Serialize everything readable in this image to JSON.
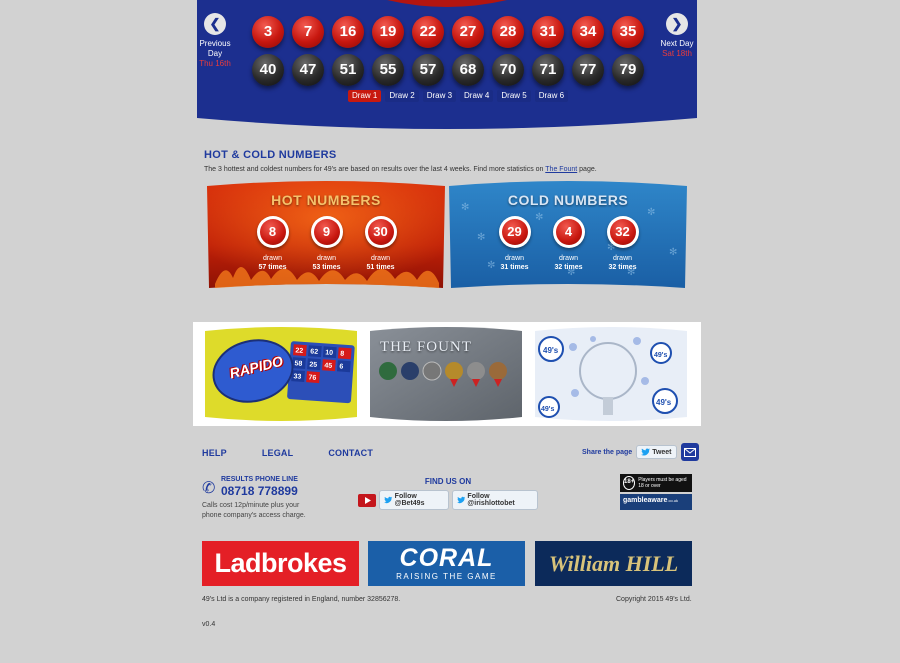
{
  "draw_panel": {
    "prev": {
      "label": "Previous Day",
      "date": "Thu 16th"
    },
    "next": {
      "label": "Next Day",
      "date": "Sat 18th"
    },
    "red_balls": [
      "3",
      "7",
      "16",
      "19",
      "22",
      "27",
      "28",
      "31",
      "34",
      "35"
    ],
    "black_balls": [
      "40",
      "47",
      "51",
      "55",
      "57",
      "68",
      "70",
      "71",
      "77",
      "79"
    ],
    "draw_tabs": [
      "Draw 1",
      "Draw 2",
      "Draw 3",
      "Draw 4",
      "Draw 5",
      "Draw 6"
    ],
    "active_tab": "Draw 1"
  },
  "hot_cold": {
    "title": "HOT & COLD NUMBERS",
    "description": "The 3 hottest and coldest numbers for 49's are based on results over the last 4 weeks. Find more statistics on",
    "link_text": "The Fount",
    "description_end": "page.",
    "hot": {
      "heading": "HOT NUMBERS",
      "items": [
        {
          "number": "8",
          "drawn": "drawn",
          "times": "57 times"
        },
        {
          "number": "9",
          "drawn": "drawn",
          "times": "53 times"
        },
        {
          "number": "30",
          "drawn": "drawn",
          "times": "51 times"
        }
      ]
    },
    "cold": {
      "heading": "COLD NUMBERS",
      "items": [
        {
          "number": "29",
          "drawn": "drawn",
          "times": "31 times"
        },
        {
          "number": "4",
          "drawn": "drawn",
          "times": "32 times"
        },
        {
          "number": "32",
          "drawn": "drawn",
          "times": "32 times"
        }
      ]
    }
  },
  "promos": {
    "rapido": {
      "text": "RAPIDO",
      "grid": [
        "22",
        "62",
        "10",
        "8",
        "58",
        "25",
        "45",
        "6",
        "33",
        "76"
      ]
    },
    "fount": {
      "text": "THE FOUNT"
    },
    "fortynines": {
      "text": "49's"
    }
  },
  "footer": {
    "links": [
      "HELP",
      "LEGAL",
      "CONTACT"
    ],
    "share_label": "Share the page",
    "tweet_label": "Tweet",
    "phone": {
      "label": "RESULTS PHONE LINE",
      "number": "08718 778899",
      "note": "Calls cost 12p/minute plus your phone company's access charge."
    },
    "find_us": {
      "title": "FIND US ON",
      "follow_1": "Follow @Bet49s",
      "follow_2": "Follow @irishlottobet"
    },
    "age": {
      "badge": "18+",
      "text": "Players must be aged 18 or over"
    },
    "gamble_aware": {
      "text": "gambleaware",
      "suffix": ".co.uk"
    },
    "sponsors": {
      "ladbrokes": "Ladbrokes",
      "coral_name": "CORAL",
      "coral_tag": "RAISING THE GAME",
      "william_hill": "William HILL"
    },
    "company": "49's Ltd is a company registered in England, number 32856278.",
    "copyright": "Copyright 2015 49's Ltd.",
    "version": "v0.4"
  },
  "colors": {
    "panel_blue": "#1c2f8f",
    "ball_red": "#c8170f",
    "ball_black": "#2a2a2a",
    "link_blue": "#1f3a9e",
    "page_bg": "#d2d2d2"
  }
}
